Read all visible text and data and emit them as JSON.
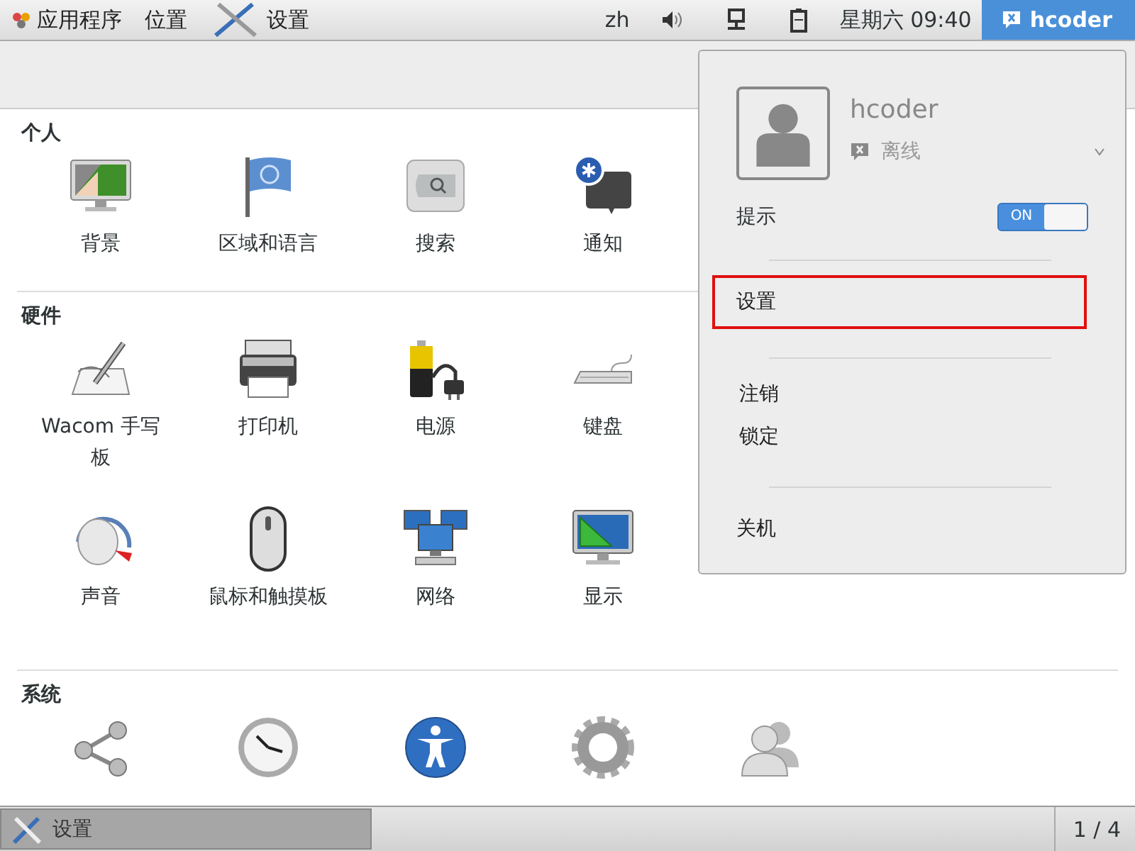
{
  "top_bar": {
    "apps_menu": "应用程序",
    "places_menu": "位置",
    "app_menu": "设置",
    "input_method": "zh",
    "clock": "星期六 09:40",
    "user": "hcoder"
  },
  "sections": [
    {
      "title": "个人",
      "rows": [
        [
          {
            "kind": "background",
            "label": "背景"
          },
          {
            "kind": "flag",
            "label": "区域和语言"
          },
          {
            "kind": "search",
            "label": "搜索"
          },
          {
            "kind": "notification",
            "label": "通知"
          }
        ]
      ]
    },
    {
      "title": "硬件",
      "rows": [
        [
          {
            "kind": "tablet",
            "label": "Wacom 手写板"
          },
          {
            "kind": "printer",
            "label": "打印机"
          },
          {
            "kind": "power",
            "label": "电源"
          },
          {
            "kind": "keyboard",
            "label": "键盘"
          }
        ],
        [
          {
            "kind": "sound",
            "label": "声音"
          },
          {
            "kind": "mouse",
            "label": "鼠标和触摸板"
          },
          {
            "kind": "network",
            "label": "网络"
          },
          {
            "kind": "display",
            "label": "显示"
          }
        ]
      ]
    },
    {
      "title": "系统",
      "rows": [
        [
          {
            "kind": "share"
          },
          {
            "kind": "clock"
          },
          {
            "kind": "accessibility"
          },
          {
            "kind": "gear"
          },
          {
            "kind": "users"
          }
        ]
      ]
    }
  ],
  "user_menu": {
    "name": "hcoder",
    "status": "离线",
    "notifications": {
      "label": "提示",
      "on": true,
      "switch_label": "ON"
    },
    "groups": [
      [
        {
          "label": "设置",
          "highlighted": true
        }
      ],
      [
        {
          "label": "注销",
          "highlighted": false
        },
        {
          "label": "锁定",
          "highlighted": false
        }
      ],
      [
        {
          "label": "关机",
          "highlighted": false
        }
      ]
    ]
  },
  "bottom_bar": {
    "window_button": {
      "label": "设置",
      "selected": true
    },
    "workspace": "1 / 4"
  }
}
